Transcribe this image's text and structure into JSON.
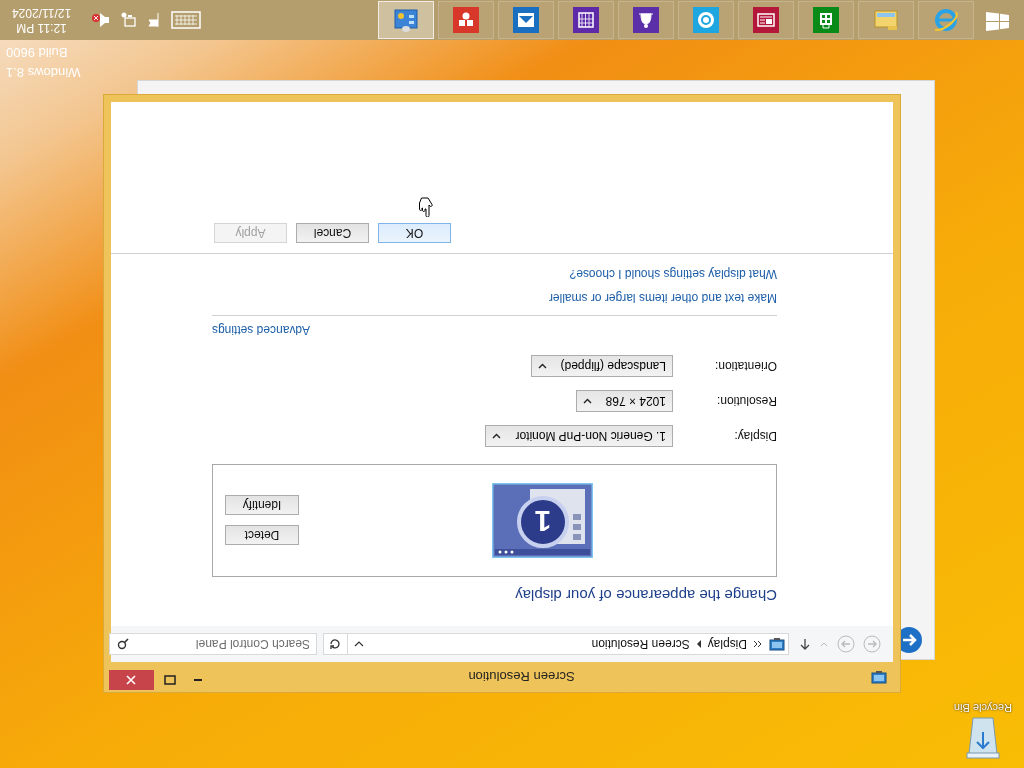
{
  "desktop": {
    "icons": [
      {
        "label": "Recycle Bin"
      }
    ],
    "watermark": [
      "Windows 8.1",
      "Build 9600"
    ]
  },
  "window": {
    "title": "Screen Resolution",
    "breadcrumb": [
      "Display",
      "Screen Resolution"
    ],
    "search": {
      "placeholder": "Search Control Panel"
    },
    "heading": "Change the appearance of your display",
    "monitor_number": "1",
    "monitor_buttons": [
      "Detect",
      "Identify"
    ],
    "settings": [
      {
        "label": "Display:",
        "value": "1. Generic Non-PnP Monitor"
      },
      {
        "label": "Resolution:",
        "value": "1024 × 768"
      },
      {
        "label": "Orientation:",
        "value": "Landscape (flipped)"
      }
    ],
    "advanced_link": "Advanced settings",
    "links": [
      "Make text and other items larger or smaller",
      "What display settings should I choose?"
    ],
    "buttons": [
      {
        "label": "OK",
        "focused": true,
        "disabled": false
      },
      {
        "label": "Cancel",
        "focused": false,
        "disabled": false
      },
      {
        "label": "Apply",
        "focused": false,
        "disabled": true
      }
    ]
  },
  "taskbar": {
    "apps": [
      {
        "kind": "start",
        "selected": false
      },
      {
        "kind": "browser",
        "selected": false
      },
      {
        "kind": "folder",
        "selected": false
      },
      {
        "kind": "store",
        "selected": false
      },
      {
        "kind": "news",
        "selected": false
      },
      {
        "kind": "skype",
        "selected": false
      },
      {
        "kind": "bell",
        "selected": false
      },
      {
        "kind": "calendar",
        "selected": false
      },
      {
        "kind": "photos",
        "selected": false
      },
      {
        "kind": "games",
        "selected": false
      },
      {
        "kind": "control",
        "selected": true
      }
    ],
    "clock": {
      "time": "12:11 PM",
      "date": "12/11/2024"
    }
  }
}
